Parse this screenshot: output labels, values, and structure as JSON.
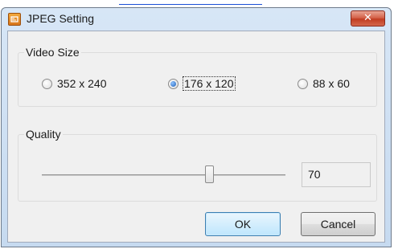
{
  "window": {
    "title": "JPEG Setting",
    "close_glyph": "✕",
    "app_icon": "app-icon"
  },
  "video_size": {
    "label": "Video Size",
    "options": [
      {
        "label": "352 x 240",
        "selected": false
      },
      {
        "label": "176 x 120",
        "selected": true
      },
      {
        "label": "88 x 60",
        "selected": false
      }
    ]
  },
  "quality": {
    "label": "Quality",
    "value": "70",
    "slider_fraction": 0.7
  },
  "buttons": {
    "ok": "OK",
    "cancel": "Cancel"
  },
  "colors": {
    "close_button": "#c13d22",
    "default_button_border": "#3c7fb1",
    "radio_selected": "#1d5fb8"
  }
}
